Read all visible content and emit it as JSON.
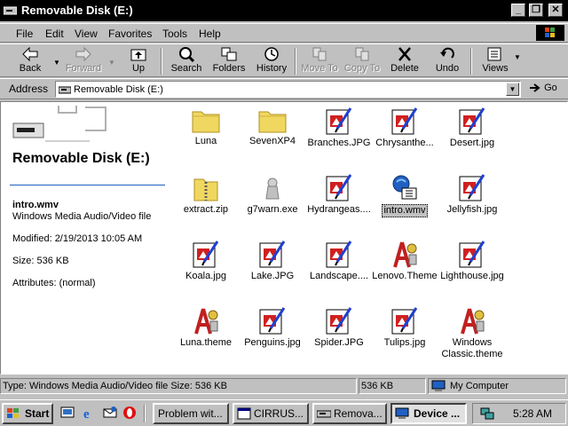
{
  "window": {
    "title": "Removable Disk (E:)"
  },
  "menu": [
    "File",
    "Edit",
    "View",
    "Favorites",
    "Tools",
    "Help"
  ],
  "toolbar": {
    "back": "Back",
    "forward": "Forward",
    "up": "Up",
    "search": "Search",
    "folders": "Folders",
    "history": "History",
    "move_to": "Move To",
    "copy_to": "Copy To",
    "delete": "Delete",
    "undo": "Undo",
    "views": "Views"
  },
  "address": {
    "label": "Address",
    "value": "Removable Disk (E:)",
    "go": "Go"
  },
  "left_pane": {
    "title": "Removable Disk (E:)",
    "selected_name": "intro.wmv",
    "selected_type": "Windows Media Audio/Video file",
    "modified": "Modified: 2/19/2013 10:05 AM",
    "size": "Size: 536 KB",
    "attributes": "Attributes: (normal)"
  },
  "files": [
    {
      "name": "Luna",
      "icon": "folder-icon"
    },
    {
      "name": "SevenXP4",
      "icon": "folder-icon"
    },
    {
      "name": "Branches.JPG",
      "icon": "image-icon"
    },
    {
      "name": "Chrysanthe...",
      "icon": "image-icon"
    },
    {
      "name": "Desert.jpg",
      "icon": "image-icon"
    },
    {
      "name": "extract.zip",
      "icon": "zip-icon"
    },
    {
      "name": "g7warn.exe",
      "icon": "exe-icon"
    },
    {
      "name": "Hydrangeas....",
      "icon": "image-icon"
    },
    {
      "name": "intro.wmv",
      "icon": "media-icon",
      "selected": true
    },
    {
      "name": "Jellyfish.jpg",
      "icon": "image-icon"
    },
    {
      "name": "Koala.jpg",
      "icon": "image-icon"
    },
    {
      "name": "Lake.JPG",
      "icon": "image-icon"
    },
    {
      "name": "Landscape....",
      "icon": "image-icon"
    },
    {
      "name": "Lenovo.Theme",
      "icon": "theme-icon"
    },
    {
      "name": "Lighthouse.jpg",
      "icon": "image-icon"
    },
    {
      "name": "Luna.theme",
      "icon": "theme-icon"
    },
    {
      "name": "Penguins.jpg",
      "icon": "image-icon"
    },
    {
      "name": "Spider.JPG",
      "icon": "image-icon"
    },
    {
      "name": "Tulips.jpg",
      "icon": "image-icon"
    },
    {
      "name": "Windows Classic.theme",
      "icon": "theme-icon"
    }
  ],
  "status": {
    "info": "Type: Windows Media Audio/Video file Size: 536 KB",
    "size": "536 KB",
    "zone": "My Computer"
  },
  "taskbar": {
    "start": "Start",
    "tasks": [
      "Problem wit...",
      "CIRRUS...",
      "Remova...",
      "Device ..."
    ],
    "clock": "5:28 AM"
  }
}
